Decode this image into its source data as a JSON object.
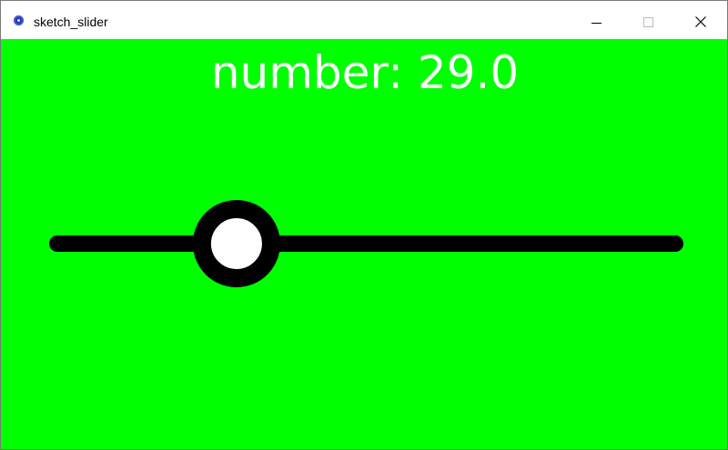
{
  "window": {
    "title": "sketch_slider",
    "app_icon": "processing-app-icon",
    "controls": [
      "minimize-icon",
      "maximize-icon",
      "close-icon"
    ]
  },
  "sketch": {
    "background_color": "#00ff00",
    "readout_text": "number: 29.0",
    "readout_color": "#ffffff"
  },
  "slider": {
    "value": 29.0,
    "min": 0,
    "max": 100,
    "track_color": "#000000",
    "knob_fill": "#ffffff",
    "knob_stroke": "#000000"
  }
}
